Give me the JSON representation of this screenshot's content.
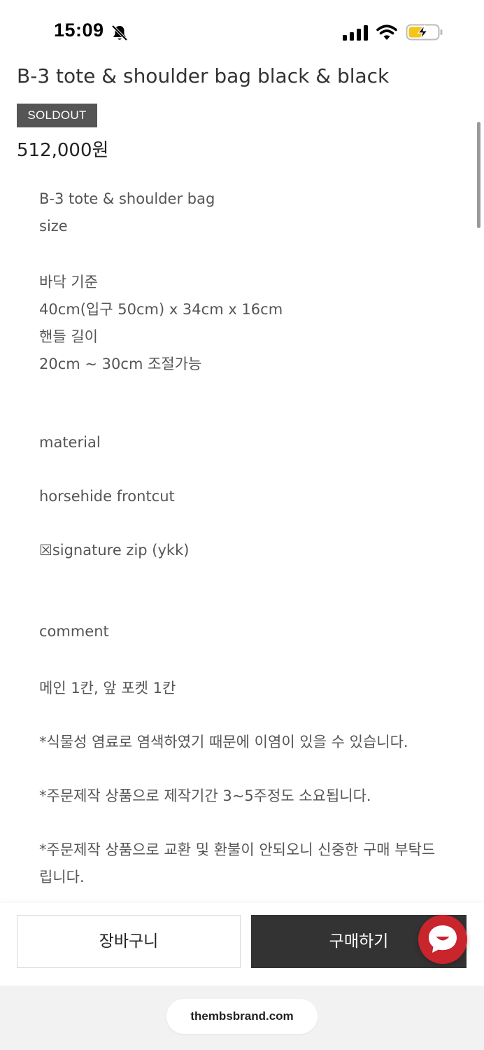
{
  "status_bar": {
    "time": "15:09",
    "icons": [
      "bell-slash-icon",
      "cellular-signal-icon",
      "wifi-icon",
      "battery-charging-icon"
    ]
  },
  "product": {
    "title": "B-3 tote & shoulder bag black & black",
    "badge": "SOLDOUT",
    "price": "512,000원"
  },
  "description": {
    "lines": [
      "B-3 tote & shoulder bag",
      "size",
      "바닥 기준",
      "40cm(입구 50cm) x 34cm x 16cm",
      "핸들 길이",
      "20cm ~ 30cm 조절가능",
      "material",
      "horsehide frontcut",
      "☒signature zip (ykk)",
      "comment",
      "메인 1칸, 앞 포켓 1칸",
      "*식물성 염료로 염색하였기 때문에 이염이 있을 수 있습니다.",
      "*주문제작 상품으로 제작기간 3~5주정도 소요됩니다.",
      "*주문제작 상품으로 교환 및 환불이 안되오니 신중한 구매 부탁드",
      "립니다."
    ]
  },
  "actions": {
    "cart_label": "장바구니",
    "buy_label": "구매하기",
    "chat_icon": "chat-bubble-icon"
  },
  "browser": {
    "url": "thembsbrand.com"
  },
  "colors": {
    "badge_bg": "#555555",
    "buy_bg": "#333333",
    "chat_bg": "#c8252d",
    "battery_fill": "#f5c518"
  }
}
